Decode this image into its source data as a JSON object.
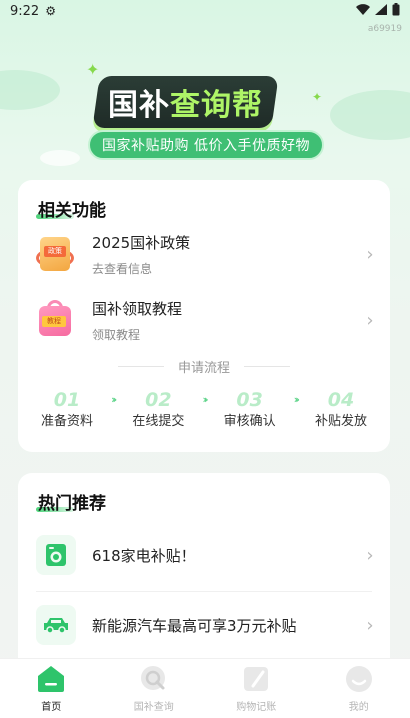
{
  "status_bar": {
    "time": "9:22",
    "build": "a69919"
  },
  "hero": {
    "logo_part1": "国补",
    "logo_part2": "查询帮",
    "slogan": "国家补贴助购 低价入手优质好物"
  },
  "related": {
    "title": "相关功能",
    "items": [
      {
        "title": "2025国补政策",
        "subtitle": "去查看信息",
        "icon_label": "政策"
      },
      {
        "title": "国补领取教程",
        "subtitle": "领取教程",
        "icon_label": "教程"
      }
    ],
    "process_label": "申请流程",
    "steps": [
      {
        "num": "01",
        "label": "准备资料"
      },
      {
        "num": "02",
        "label": "在线提交"
      },
      {
        "num": "03",
        "label": "审核确认"
      },
      {
        "num": "04",
        "label": "补贴发放"
      }
    ]
  },
  "hot": {
    "title": "热门推荐",
    "items": [
      {
        "title": "618家电补贴！",
        "icon": "washing-machine-icon"
      },
      {
        "title": "新能源汽车最高可享3万元补贴",
        "icon": "car-icon"
      }
    ]
  },
  "tabbar": {
    "tabs": [
      {
        "label": "首页",
        "icon": "home-icon",
        "active": true
      },
      {
        "label": "国补查询",
        "icon": "search-icon",
        "active": false
      },
      {
        "label": "购物记账",
        "icon": "note-icon",
        "active": false
      },
      {
        "label": "我的",
        "icon": "profile-icon",
        "active": false
      }
    ]
  },
  "colors": {
    "accent": "#2ec46b",
    "logo_green": "#aef567"
  }
}
